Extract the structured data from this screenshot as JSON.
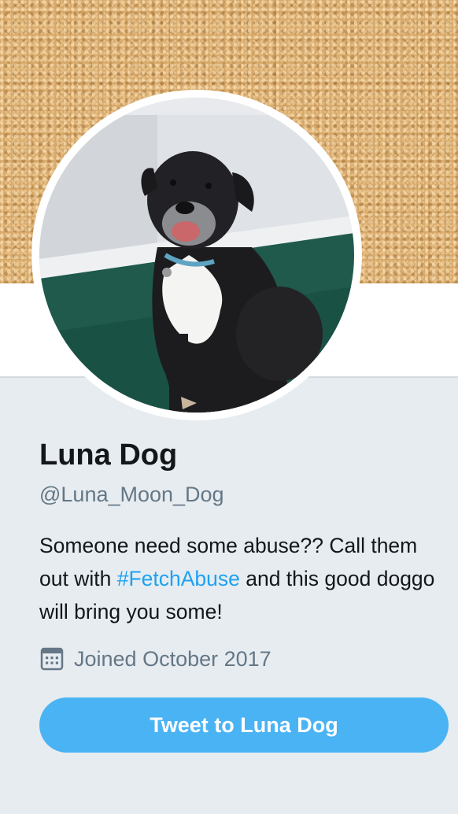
{
  "profile": {
    "display_name": "Luna Dog",
    "handle": "@Luna_Moon_Dog",
    "bio_before": "Someone need some abuse?? Call them out with ",
    "bio_hashtag": "#FetchAbuse",
    "bio_after": " and this good doggo will bring you some!",
    "joined": "Joined October 2017"
  },
  "actions": {
    "tweet_button_label": "Tweet to Luna Dog"
  },
  "icons": {
    "joined": "calendar-icon"
  },
  "colors": {
    "background": "#e6ecf0",
    "primary_text": "#14171a",
    "secondary_text": "#657786",
    "link": "#1da1f2",
    "button": "#4ab3f4",
    "banner": "#d6a86a"
  }
}
